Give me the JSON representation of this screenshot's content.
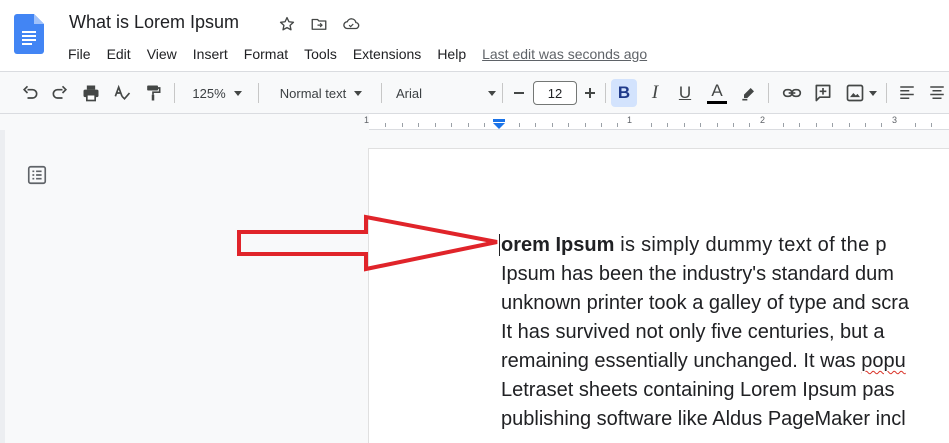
{
  "document": {
    "title": "What is Lorem Ipsum",
    "icons": [
      "star-icon",
      "move-to-folder-icon",
      "cloud-saved-icon"
    ]
  },
  "menu": {
    "items": [
      "File",
      "Edit",
      "View",
      "Insert",
      "Format",
      "Tools",
      "Extensions",
      "Help"
    ],
    "last_edit": "Last edit was seconds ago"
  },
  "toolbar": {
    "zoom": "125%",
    "style": "Normal text",
    "font": "Arial",
    "font_size": "12",
    "bold_label": "B",
    "italic_label": "I",
    "underline_label": "U",
    "text_color_label": "A"
  },
  "ruler": {
    "numbers": [
      "1",
      "1",
      "2",
      "3"
    ]
  },
  "body": {
    "first_word_bold": "orem Ipsum",
    "lines": [
      " is simply dummy text of the p",
      "Ipsum has been the industry's standard dum",
      "unknown printer took a galley of type and scra",
      "It has survived not only five centuries, but a",
      "remaining essentially unchanged. It was ",
      "Letraset sheets containing Lorem Ipsum pas",
      "publishing software like Aldus PageMaker incl"
    ],
    "misspelled_fragment": "popu"
  },
  "colors": {
    "accent": "#1a73e8",
    "bold_active_bg": "#d3e3fd",
    "annotation_arrow": "#e0242a"
  }
}
